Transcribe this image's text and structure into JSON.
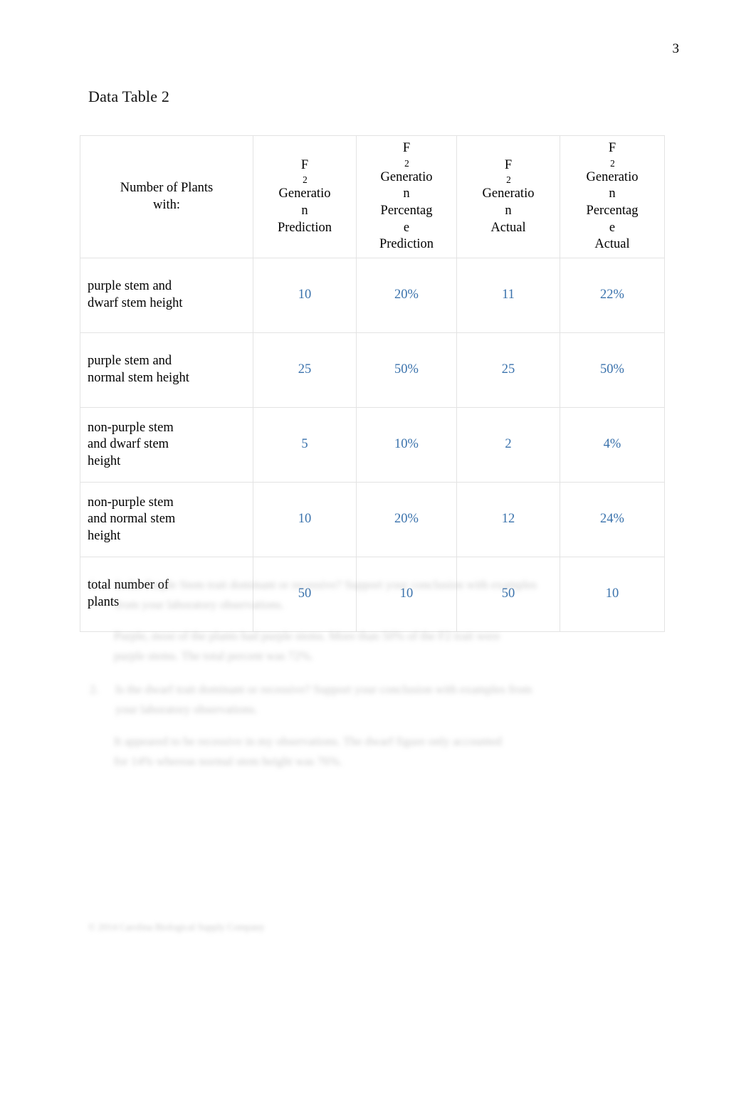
{
  "page": {
    "number": "3",
    "title": "Data Table 2",
    "accent_blue": "#3a72ac",
    "text_black": "#000000",
    "border_gray": "#e3e3e3",
    "background": "#ffffff"
  },
  "table": {
    "name": "Data Table 2",
    "headers": [
      {
        "lines": [
          "",
          "Number of Plants",
          "with:",
          "",
          ""
        ]
      },
      {
        "lines": [
          "F2",
          "Generatio",
          "n",
          "Prediction"
        ]
      },
      {
        "lines": [
          "F2",
          "Generatio",
          "n",
          "Percentag",
          "e",
          "Prediction"
        ]
      },
      {
        "lines": [
          "F2",
          "Generatio",
          "n",
          "Actual"
        ]
      },
      {
        "lines": [
          "F2",
          "Generatio",
          "n",
          "Percentag",
          "e",
          "Actual"
        ]
      }
    ],
    "header_plain": [
      "Number of Plants with:",
      "F2 Generation Prediction",
      "F2 Generation Percentage Prediction",
      "F2 Generation Actual",
      "F2 Generation Percentage Actual"
    ],
    "rows": [
      {
        "label_lines": [
          "purple stem and",
          "dwarf stem height"
        ],
        "label": "purple stem and dwarf stem height",
        "prediction": "10",
        "prediction_percent": "20%",
        "actual": "11",
        "actual_percent": "22%"
      },
      {
        "label_lines": [
          "purple stem and",
          "normal stem height"
        ],
        "label": "purple stem and normal stem height",
        "prediction": "25",
        "prediction_percent": "50%",
        "actual": "25",
        "actual_percent": "50%"
      },
      {
        "label_lines": [
          "non-purple stem",
          "and dwarf stem",
          "height"
        ],
        "label": "non-purple stem and dwarf stem height",
        "prediction": "5",
        "prediction_percent": "10%",
        "actual": "2",
        "actual_percent": "4%"
      },
      {
        "label_lines": [
          "non-purple stem",
          "and normal stem",
          "height"
        ],
        "label": "non-purple stem and normal stem height",
        "prediction": "10",
        "prediction_percent": "20%",
        "actual": "12",
        "actual_percent": "24%"
      },
      {
        "label_lines": [
          "total number of",
          "plants"
        ],
        "label": "total number of plants",
        "prediction": "50",
        "prediction_percent": "10",
        "actual": "50",
        "actual_percent": "10"
      }
    ]
  },
  "chart_data": {
    "type": "table",
    "title": "Data Table 2",
    "columns": [
      "Number of Plants with:",
      "F2 Generation Prediction",
      "F2 Generation Percentage Prediction",
      "F2 Generation Actual",
      "F2 Generation Percentage Actual"
    ],
    "categories": [
      "purple stem and dwarf stem height",
      "purple stem and normal stem height",
      "non-purple stem and dwarf stem height",
      "non-purple stem and normal stem height",
      "total number of plants"
    ],
    "series": [
      {
        "name": "F2 Generation Prediction",
        "values": [
          10,
          25,
          5,
          10,
          50
        ]
      },
      {
        "name": "F2 Generation Percentage Prediction",
        "values": [
          "20%",
          "50%",
          "10%",
          "20%",
          "10"
        ]
      },
      {
        "name": "F2 Generation Actual",
        "values": [
          11,
          25,
          2,
          12,
          50
        ]
      },
      {
        "name": "F2 Generation Percentage Actual",
        "values": [
          "22%",
          "50%",
          "4%",
          "24%",
          "10"
        ]
      }
    ]
  },
  "redacted": {
    "q1_number": "1.",
    "q1_text": "Is the Purple Stem trait dominant or recessive? Support your conclusion with examples from your laboratory observations.",
    "a1_text": "Purple, most of the plants had purple stems. More than 50% of the F2 trait were purple stems. The total percent was 72%.",
    "q2_number": "2.",
    "q2_text": "Is the dwarf trait dominant or recessive? Support your conclusion with examples from your laboratory observations.",
    "a2_text": "It appeared to be recessive in my observations. The dwarf figure only accounted for 14% whereas normal stem height was 76%.",
    "footer_text": "© 2014 Carolina Biological Supply Company"
  }
}
